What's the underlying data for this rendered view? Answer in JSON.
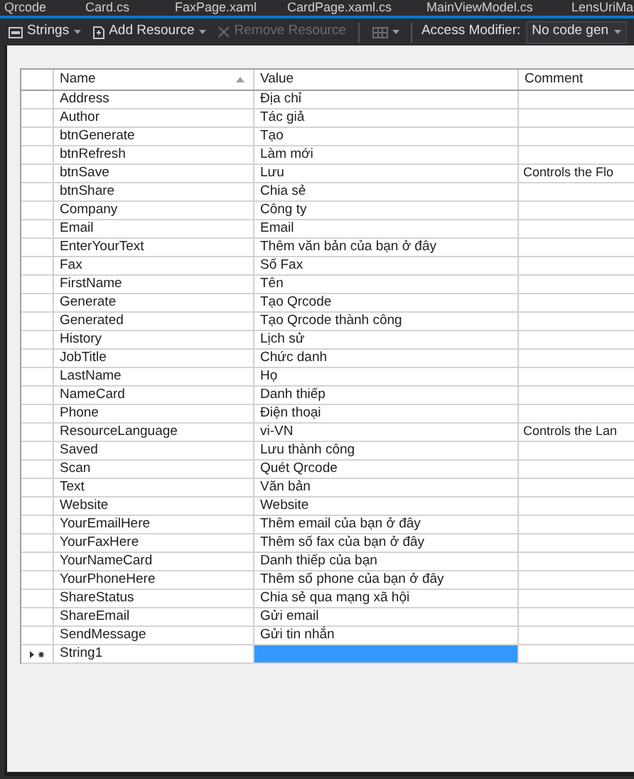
{
  "tabs": [
    {
      "label": "Qrcode"
    },
    {
      "label": "Card.cs"
    },
    {
      "label": "FaxPage.xaml"
    },
    {
      "label": "CardPage.xaml.cs"
    },
    {
      "label": "MainViewModel.cs"
    },
    {
      "label": "LensUriMa"
    }
  ],
  "toolbar": {
    "items": [
      {
        "kind": "strings",
        "label": "Strings",
        "disabled": false
      },
      {
        "kind": "add",
        "label": "Add Resource",
        "disabled": false
      },
      {
        "kind": "remove",
        "label": "Remove Resource",
        "disabled": true
      },
      {
        "kind": "view",
        "disabled": true
      }
    ],
    "access_modifier": {
      "label": "Access Modifier:",
      "value": "No code gen"
    }
  },
  "table": {
    "columns": [
      {
        "label": "Name",
        "sorted": true
      },
      {
        "label": "Value",
        "sorted": false
      },
      {
        "label": "Comment",
        "sorted": false
      }
    ],
    "rows": [
      {
        "kind": "entry",
        "name": "Address",
        "value": "Địa chỉ",
        "selected": false
      },
      {
        "kind": "entry",
        "name": "Author",
        "value": "Tác giả",
        "selected": false
      },
      {
        "kind": "entry",
        "name": "btnGenerate",
        "value": "Tạo",
        "selected": false
      },
      {
        "kind": "entry",
        "name": "btnRefresh",
        "value": "Làm mới",
        "selected": false
      },
      {
        "kind": "entry",
        "name": "btnSave",
        "value": "Lưu",
        "comment": "Controls the Flo",
        "selected": false
      },
      {
        "kind": "entry",
        "name": "btnShare",
        "value": "Chia sẻ",
        "selected": false
      },
      {
        "kind": "entry",
        "name": "Company",
        "value": "Công ty",
        "selected": false
      },
      {
        "kind": "entry",
        "name": "Email",
        "value": "Email",
        "selected": false
      },
      {
        "kind": "entry",
        "name": "EnterYourText",
        "value": "Thêm văn bản của bạn ở đây",
        "selected": false
      },
      {
        "kind": "entry",
        "name": "Fax",
        "value": "Số Fax",
        "selected": false
      },
      {
        "kind": "entry",
        "name": "FirstName",
        "value": "Tên",
        "selected": false
      },
      {
        "kind": "entry",
        "name": "Generate",
        "value": "Tạo Qrcode",
        "selected": false
      },
      {
        "kind": "entry",
        "name": "Generated",
        "value": "Tạo Qrcode thành công",
        "selected": false
      },
      {
        "kind": "entry",
        "name": "History",
        "value": "Lịch sử",
        "selected": false
      },
      {
        "kind": "entry",
        "name": "JobTitle",
        "value": "Chức danh",
        "selected": false
      },
      {
        "kind": "entry",
        "name": "LastName",
        "value": "Họ",
        "selected": false
      },
      {
        "kind": "entry",
        "name": "NameCard",
        "value": "Danh thiếp",
        "selected": false
      },
      {
        "kind": "entry",
        "name": "Phone",
        "value": "Điện thoại",
        "selected": false
      },
      {
        "kind": "entry",
        "name": "ResourceLanguage",
        "value": "vi-VN",
        "comment": "Controls the Lan",
        "selected": false
      },
      {
        "kind": "entry",
        "name": "Saved",
        "value": "Lưu thành công",
        "selected": false
      },
      {
        "kind": "entry",
        "name": "Scan",
        "value": "Quét Qrcode",
        "selected": false
      },
      {
        "kind": "entry",
        "name": "Text",
        "value": "Văn bản",
        "selected": false
      },
      {
        "kind": "entry",
        "name": "Website",
        "value": "Website",
        "selected": false
      },
      {
        "kind": "entry",
        "name": "YourEmailHere",
        "value": "Thêm email của bạn ở đây",
        "selected": false
      },
      {
        "kind": "entry",
        "name": "YourFaxHere",
        "value": "Thêm số fax của bạn ở đây",
        "selected": false
      },
      {
        "kind": "entry",
        "name": "YourNameCard",
        "value": "Danh thiếp của bạn",
        "selected": false
      },
      {
        "kind": "entry",
        "name": "YourPhoneHere",
        "value": "Thêm số phone của bạn ở đây",
        "selected": false
      },
      {
        "kind": "entry",
        "name": "ShareStatus",
        "value": "Chia sẻ qua mạng xã hội",
        "selected": false
      },
      {
        "kind": "entry",
        "name": "ShareEmail",
        "value": "Gửi email",
        "selected": false
      },
      {
        "kind": "entry",
        "name": "SendMessage",
        "value": "Gửi tin nhắn",
        "selected": false
      },
      {
        "kind": "new",
        "name": "String1",
        "value": "",
        "selected": true
      }
    ]
  }
}
